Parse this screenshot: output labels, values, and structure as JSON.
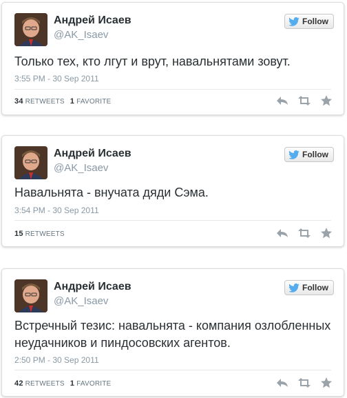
{
  "tweets": [
    {
      "name": "Андрей Исаев",
      "handle": "@AK_Isaev",
      "follow_label": "Follow",
      "text": "Только тех, кто лгут и врут, навальнятами зовут.",
      "timestamp": "3:55 PM - 30 Sep 2011",
      "retweets_count": "34",
      "retweets_label": "RETWEETS",
      "favorites_count": "1",
      "favorites_label": "FAVORITE"
    },
    {
      "name": "Андрей Исаев",
      "handle": "@AK_Isaev",
      "follow_label": "Follow",
      "text": "Навальнята - внучата дяди Сэма.",
      "timestamp": "3:54 PM - 30 Sep 2011",
      "retweets_count": "15",
      "retweets_label": "RETWEETS"
    },
    {
      "name": "Андрей Исаев",
      "handle": "@AK_Isaev",
      "follow_label": "Follow",
      "text": "Встречный тезис: навальнята - компания озлобленных неудачников и пиндосовских агентов.",
      "timestamp": "2:50 PM - 30 Sep 2011",
      "retweets_count": "42",
      "retweets_label": "RETWEETS",
      "favorites_count": "1",
      "favorites_label": "FAVORITE"
    }
  ],
  "icons": {
    "bird": "twitter-bird-icon",
    "reply": "reply-icon",
    "retweet": "retweet-icon",
    "favorite": "star-icon"
  },
  "colors": {
    "twitter_blue": "#55acee",
    "action_gray": "#9aa3aa"
  }
}
